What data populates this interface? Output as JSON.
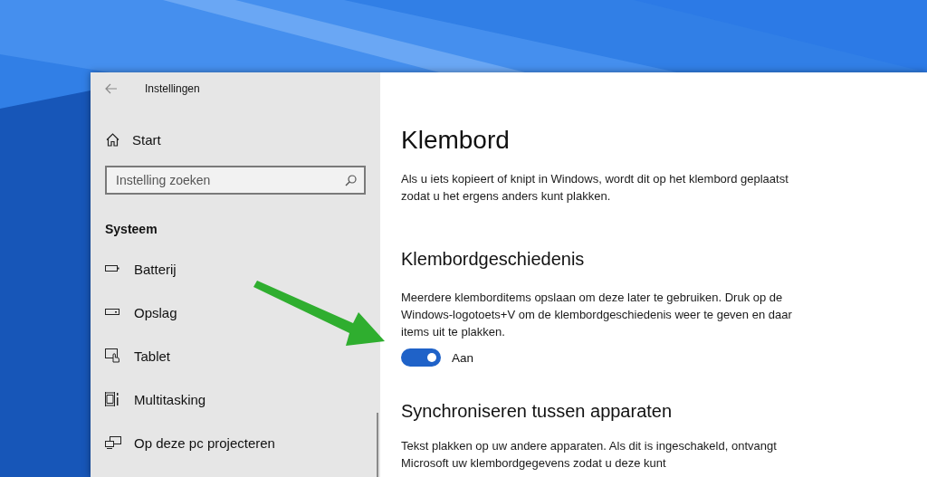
{
  "window": {
    "title": "Instellingen"
  },
  "sidebar": {
    "home": "Start",
    "search": {
      "placeholder": "Instelling zoeken"
    },
    "section": "Systeem",
    "items": [
      {
        "kind": "battery",
        "label": "Batterij"
      },
      {
        "kind": "storage",
        "label": "Opslag"
      },
      {
        "kind": "tablet",
        "label": "Tablet"
      },
      {
        "kind": "multitasking",
        "label": "Multitasking"
      },
      {
        "kind": "project",
        "label": "Op deze pc projecteren"
      }
    ]
  },
  "content": {
    "title": "Klembord",
    "intro": "Als u iets kopieert of knipt in Windows, wordt dit op het klembord geplaatst zodat u het ergens anders kunt plakken.",
    "sections": [
      {
        "heading": "Klembordgeschiedenis",
        "text": "Meerdere klemborditems opslaan om deze later te gebruiken. Druk op de Windows-logotoets+V om de klembordgeschiedenis weer te geven en daar items uit te plakken.",
        "toggle": {
          "on": true,
          "label": "Aan"
        }
      },
      {
        "heading": "Synchroniseren tussen apparaten",
        "text": "Tekst plakken op uw andere apparaten. Als dit is ingeschakeld, ontvangt Microsoft uw klembordgegevens zodat u deze kunt"
      }
    ]
  }
}
